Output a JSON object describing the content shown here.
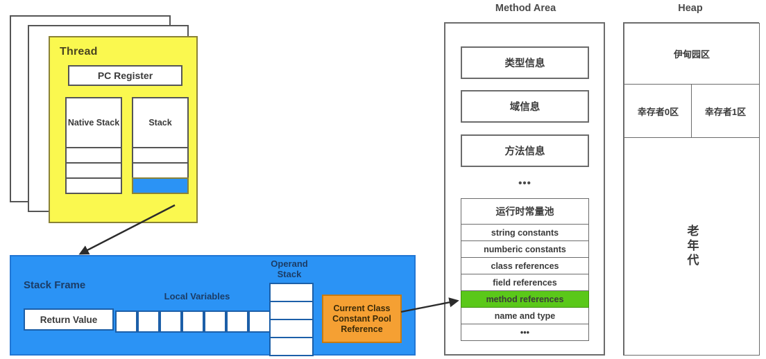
{
  "diagram": {
    "title_method_area": "Method Area",
    "title_heap": "Heap",
    "accent_colors": {
      "thread_yellow": "#faf84f",
      "frame_blue": "#2b93f5",
      "highlight_green": "#5ac819",
      "pool_ref_orange": "#f5a033",
      "outline_gray": "#6b6b6b"
    }
  },
  "thread": {
    "label": "Thread",
    "pc_register": "PC Register",
    "native_stack": {
      "label": "Native Stack",
      "empty_cells": 3
    },
    "stack": {
      "label": "Stack",
      "empty_cells": 2,
      "active_cell_filled": true
    }
  },
  "stack_frame": {
    "label": "Stack Frame",
    "return_value": "Return Value",
    "local_variables": {
      "label": "Local Variables",
      "slots": 7
    },
    "operand_stack": {
      "label": "Operand Stack",
      "slots": 4
    },
    "constant_pool_reference": "Current Class Constant Pool Reference"
  },
  "method_area": {
    "title": "Method Area",
    "blocks": [
      "类型信息",
      "域信息",
      "方法信息"
    ],
    "separator": "•••",
    "runtime_constant_pool": {
      "title": "运行时常量池",
      "entries": [
        {
          "label": "string constants",
          "highlight": false
        },
        {
          "label": "numberic constants",
          "highlight": false
        },
        {
          "label": "class references",
          "highlight": false
        },
        {
          "label": "field references",
          "highlight": false
        },
        {
          "label": "method references",
          "highlight": true
        },
        {
          "label": "name and type",
          "highlight": false
        },
        {
          "label": "•••",
          "highlight": false
        }
      ]
    }
  },
  "heap": {
    "title": "Heap",
    "eden": "伊甸园区",
    "survivor_0": "幸存者0区",
    "survivor_1": "幸存者1区",
    "old_generation": "老年代"
  }
}
